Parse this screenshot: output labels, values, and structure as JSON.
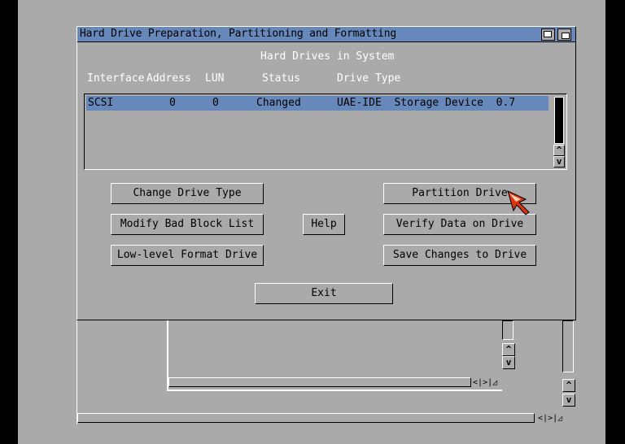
{
  "window": {
    "title": "Hard Drive Preparation, Partitioning and Formatting",
    "heading": "Hard Drives in System"
  },
  "columns": [
    "Interface",
    "Address",
    "LUN",
    "Status",
    "Drive Type"
  ],
  "drives": [
    {
      "interface": "SCSI",
      "address": "0",
      "lun": "0",
      "status": "Changed",
      "drive_type": "UAE-IDE  Storage Device  0.7"
    }
  ],
  "buttons": {
    "change_drive_type": "Change Drive Type",
    "modify_bad_block": "Modify Bad Block List",
    "low_level_format": "Low-level Format Drive",
    "help": "Help",
    "partition_drive": "Partition Drive",
    "verify_data": "Verify Data on Drive",
    "save_changes": "Save Changes to Drive",
    "exit": "Exit"
  },
  "scroll_arrows": {
    "up": "^",
    "down": "v",
    "left": "<",
    "right": ">"
  },
  "colors": {
    "title_bar": "#6688bb",
    "background": "#aaaaaa",
    "pointer": "#dd3311"
  }
}
